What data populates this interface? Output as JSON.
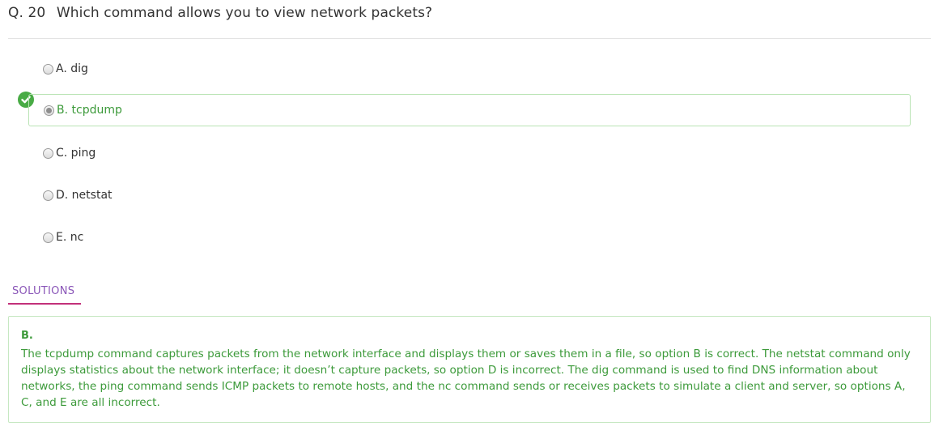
{
  "question": {
    "number": "Q. 20",
    "text": "Which command allows you to view network packets?"
  },
  "options": [
    {
      "label": "A. dig",
      "selected": false,
      "correct": false
    },
    {
      "label": "B. tcpdump",
      "selected": true,
      "correct": true
    },
    {
      "label": "C. ping",
      "selected": false,
      "correct": false
    },
    {
      "label": "D. netstat",
      "selected": false,
      "correct": false
    },
    {
      "label": "E. nc",
      "selected": false,
      "correct": false
    }
  ],
  "solutions": {
    "tab_label": "SOLUTIONS",
    "answer": "B.",
    "explanation": "The tcpdump command captures packets from the network interface and displays them or saves them in a file, so option B is correct. The netstat command only displays statistics about the network interface; it doesn’t capture packets, so option D is incorrect. The dig command is used to find DNS information about networks, the ping command sends ICMP packets to remote hosts, and the nc command sends or receives packets to simulate a client and server, so options A, C, and E are all incorrect."
  },
  "colors": {
    "correct_green": "#48ab45",
    "correct_text": "#3c9a3a",
    "tab_underline": "#c2307a",
    "tab_text": "#8a56b8"
  },
  "icons": {
    "correct_marker": "check-circle-icon"
  }
}
